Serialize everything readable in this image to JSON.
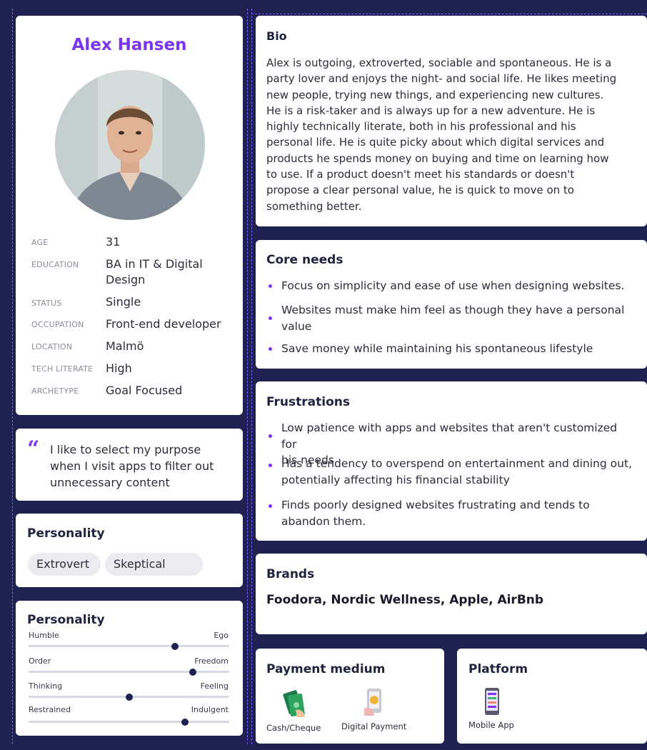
{
  "profile": {
    "name": "Alex Hansen",
    "attributes": [
      {
        "label": "AGE",
        "value": "31"
      },
      {
        "label": "EDUCATION",
        "value_line1": "BA in IT & Digital",
        "value_line2": "Design"
      },
      {
        "label": "STATUS",
        "value": "Single"
      },
      {
        "label": "OCCUPATION",
        "value": "Front-end developer"
      },
      {
        "label": "LOCATION",
        "value": "Malmö"
      },
      {
        "label": "TECH LITERATE",
        "value": "High"
      },
      {
        "label": "ARCHETYPE",
        "value": "Goal Focused"
      }
    ]
  },
  "quote": {
    "mark": "“",
    "lines": [
      "I like to select my purpose",
      "when I visit apps to filter out",
      "unnecessary content"
    ]
  },
  "personality_traits": {
    "title": "Personality",
    "chips": [
      "Extrovert",
      "Skeptical"
    ]
  },
  "personality_sliders": {
    "title": "Personality",
    "sliders": [
      {
        "left": "Humble",
        "right": "Ego",
        "value": 0.73
      },
      {
        "left": "Order",
        "right": "Freedom",
        "value": 0.82
      },
      {
        "left": "Thinking",
        "right": "Feeling",
        "value": 0.5
      },
      {
        "left": "Restrained",
        "right": "Indulgent",
        "value": 0.78
      }
    ]
  },
  "bio": {
    "title": "Bio",
    "lines": [
      "Alex is outgoing, extroverted, sociable and spontaneous. He is a",
      "party lover and enjoys the night- and social life. He likes meeting",
      "new people, trying new things, and experiencing new cultures.",
      "He is a risk-taker and is always up for a new adventure. He is",
      "highly technically literate, both in his professional and his",
      "personal life. He is quite picky about which digital services and",
      "products he spends money on buying and time on learning how",
      "to use. If a product doesn't meet his standards or doesn't",
      "propose a clear personal value, he is quick to move on to",
      "something better."
    ]
  },
  "core_needs": {
    "title": "Core needs",
    "items": [
      {
        "line1": "Focus on simplicity and ease of use when designing websites."
      },
      {
        "line1": "Websites must make him feel as though they have a personal",
        "line2": "value"
      },
      {
        "line1": "Save money while maintaining his spontaneous lifestyle"
      }
    ]
  },
  "frustrations": {
    "title": "Frustrations",
    "items": [
      {
        "line1": "Low patience with apps and websites that aren't customized for",
        "line2": "his needs"
      },
      {
        "line1": "Has a tendency to overspend on entertainment and dining out,",
        "line2": "potentially affecting his financial stability"
      },
      {
        "line1": "Finds poorly designed websites frustrating and tends to",
        "line2": "abandon them."
      }
    ]
  },
  "brands": {
    "title": "Brands",
    "text": "Foodora, Nordic Wellness, Apple, AirBnb"
  },
  "payment": {
    "title": "Payment medium",
    "items": [
      {
        "label": "Cash/Cheque",
        "icon": "cash-icon"
      },
      {
        "label": "Digital Payment",
        "icon": "digital-payment-icon"
      }
    ]
  },
  "platform": {
    "title": "Platform",
    "items": [
      {
        "label": "Mobile App",
        "icon": "mobile-app-icon"
      }
    ]
  },
  "colors": {
    "background": "#1f2150",
    "accent": "#7a35f0"
  }
}
